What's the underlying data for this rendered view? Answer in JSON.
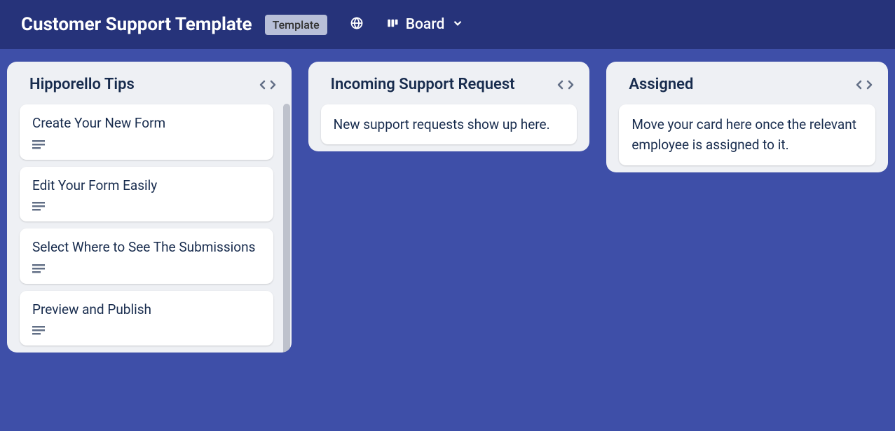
{
  "header": {
    "title": "Customer Support Template",
    "badge": "Template",
    "view_label": "Board"
  },
  "lists": [
    {
      "title": "Hipporello Tips",
      "cards": [
        {
          "title": "Create Your New Form",
          "has_description": true
        },
        {
          "title": "Edit Your Form Easily",
          "has_description": true
        },
        {
          "title": "Select Where to See The Submissions",
          "has_description": true
        },
        {
          "title": "Preview and Publish",
          "has_description": true
        }
      ]
    },
    {
      "title": "Incoming Support Request",
      "cards": [
        {
          "title": "New support requests show up here.",
          "has_description": false
        }
      ]
    },
    {
      "title": "Assigned",
      "cards": [
        {
          "title": "Move your card here once the relevant employee is assigned to it.",
          "has_description": false
        }
      ]
    }
  ]
}
